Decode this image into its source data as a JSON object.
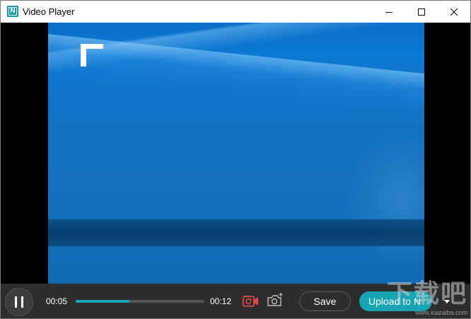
{
  "window": {
    "title": "Video Player",
    "app_icon_letter": "N",
    "controls": [
      "minimize-icon",
      "maximize-icon",
      "close-icon"
    ]
  },
  "video": {
    "overlay_icon": "corner-bracket-icon"
  },
  "player": {
    "current_time": "00:05",
    "total_time": "00:12",
    "progress_fraction": 0.42,
    "accent_color": "#1aa8b5",
    "record_icon_color": "#e04848",
    "save_label": "Save",
    "upload_label": "Upload to N"
  },
  "watermark": {
    "text": "下载吧",
    "url": "www.xiazaiba.com"
  }
}
